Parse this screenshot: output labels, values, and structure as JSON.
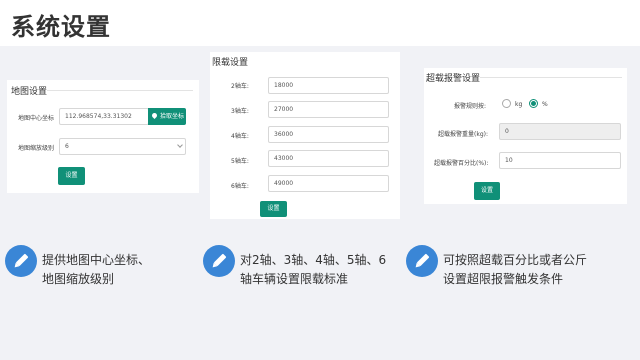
{
  "page_title": "系统设置",
  "map_panel": {
    "title": "地图设置",
    "center_label": "地图中心坐标",
    "center_value": "112.968574,33.31302",
    "pick_button": "拾取坐标",
    "zoom_label": "地图缩放级别",
    "zoom_value": "6",
    "save_button": "设置"
  },
  "limit_panel": {
    "title": "限载设置",
    "rows": [
      {
        "label": "2轴车:",
        "value": "18000"
      },
      {
        "label": "3轴车:",
        "value": "27000"
      },
      {
        "label": "4轴车:",
        "value": "36000"
      },
      {
        "label": "5轴车:",
        "value": "43000"
      },
      {
        "label": "6轴车:",
        "value": "49000"
      }
    ],
    "save_button": "设置"
  },
  "alarm_panel": {
    "title": "超载报警设置",
    "rule_label": "报警规则按:",
    "rule_options": [
      "kg",
      "%"
    ],
    "rule_selected": "%",
    "weight_label": "超载报警重量(kg):",
    "weight_value": "0",
    "percent_label": "超载报警百分比(%):",
    "percent_value": "10",
    "save_button": "设置"
  },
  "features": [
    {
      "line1": "提供地图中心坐标、",
      "line2": "地图缩放级别"
    },
    {
      "line1": "对2轴、3轴、4轴、5轴、6",
      "line2": "轴车辆设置限载标准"
    },
    {
      "line1": "可按照超载百分比或者公斤",
      "line2": "设置超限报警触发条件"
    }
  ],
  "colors": {
    "accent": "#109078",
    "icon_bg": "#3a86d6",
    "background": "#f1f2f6"
  }
}
